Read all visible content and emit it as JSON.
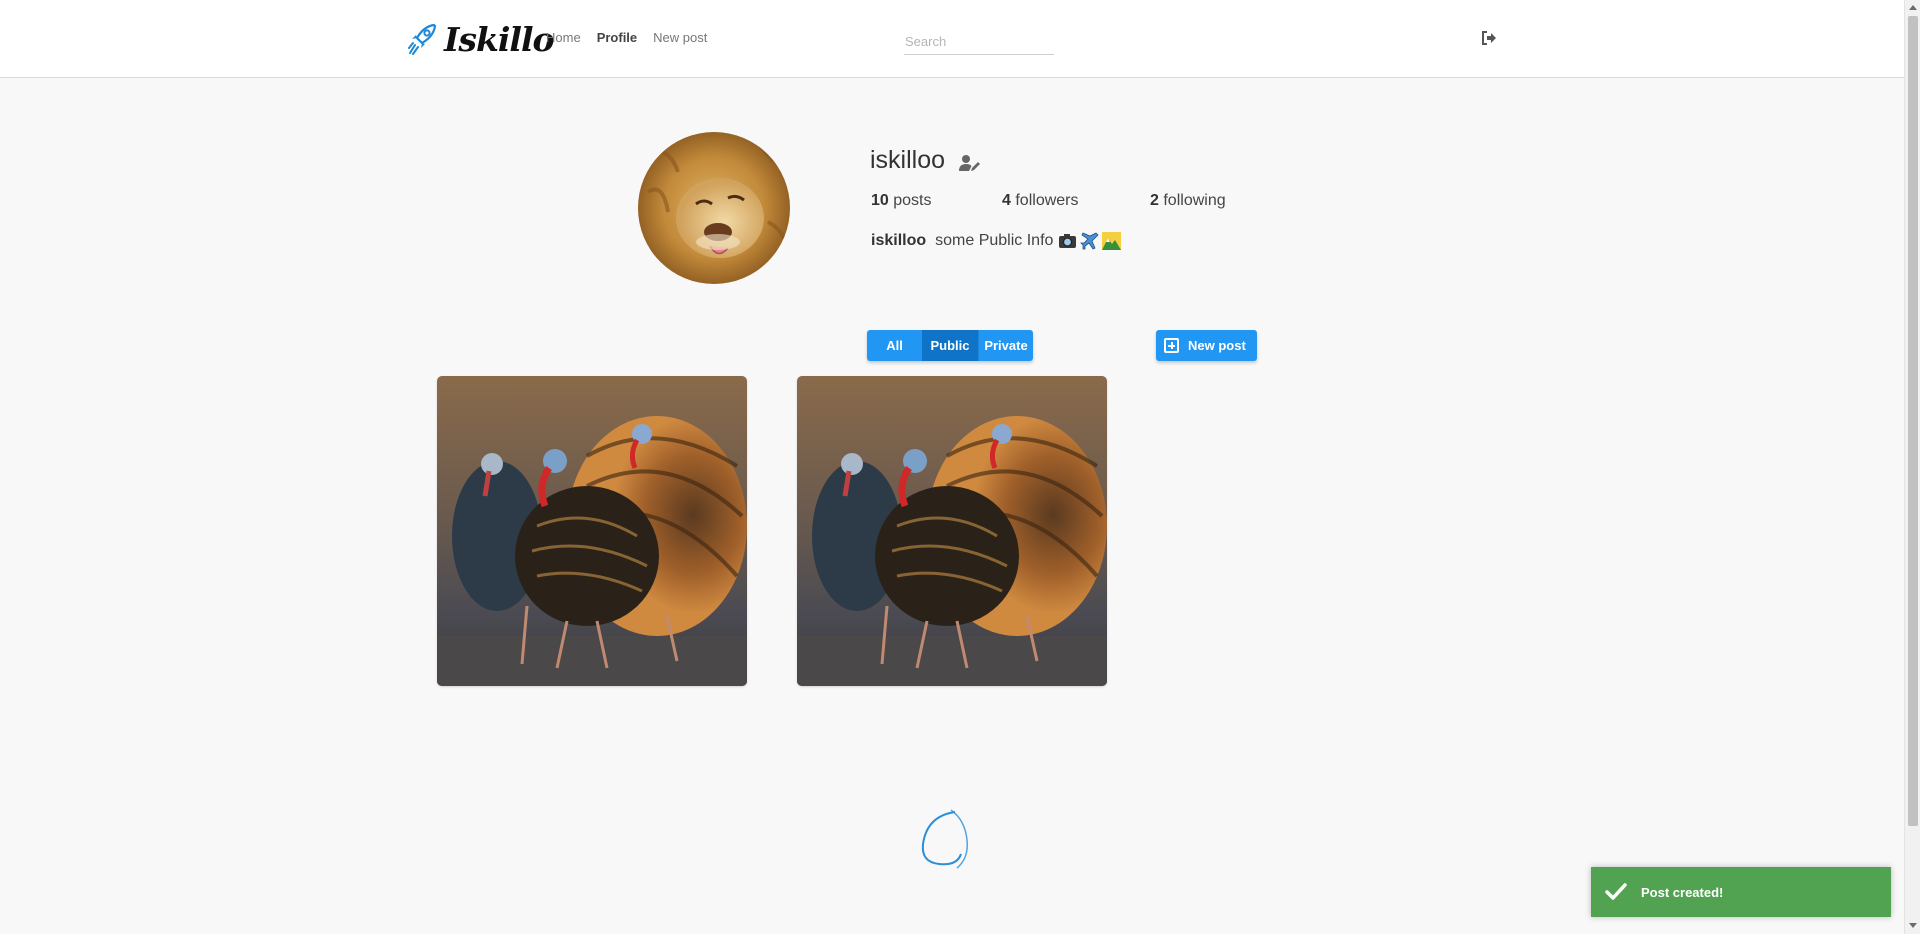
{
  "brand": {
    "name": "Iskillo",
    "accent_color": "#2196f3",
    "logo_icon": "rocket-icon"
  },
  "nav": {
    "links": [
      {
        "label": "Home",
        "active": false
      },
      {
        "label": "Profile",
        "active": true
      },
      {
        "label": "New post",
        "active": false
      }
    ],
    "search_placeholder": "Search",
    "logout_icon": "sign-out-icon"
  },
  "profile": {
    "username": "iskilloo",
    "edit_icon": "user-edit-icon",
    "stats": {
      "posts_count": "10",
      "posts_label": "posts",
      "followers_count": "4",
      "followers_label": "followers",
      "following_count": "2",
      "following_label": "following"
    },
    "bio": {
      "name": "iskilloo",
      "text": "some Public Info",
      "emojis": [
        "camera-emoji",
        "airplane-emoji",
        "mountain-emoji"
      ]
    },
    "avatar_description_icon": "lion-avatar"
  },
  "filters": {
    "options": [
      "All",
      "Public",
      "Private"
    ],
    "selected": "Public"
  },
  "new_post_button": {
    "label": "New post",
    "icon": "plus-square-icon"
  },
  "posts": [
    {
      "image": "turkey-photo"
    },
    {
      "image": "turkey-photo"
    }
  ],
  "loading_indicator": "spinner-icon",
  "toast": {
    "message": "Post created!",
    "icon": "checkmark-icon",
    "color": "#51a351"
  }
}
